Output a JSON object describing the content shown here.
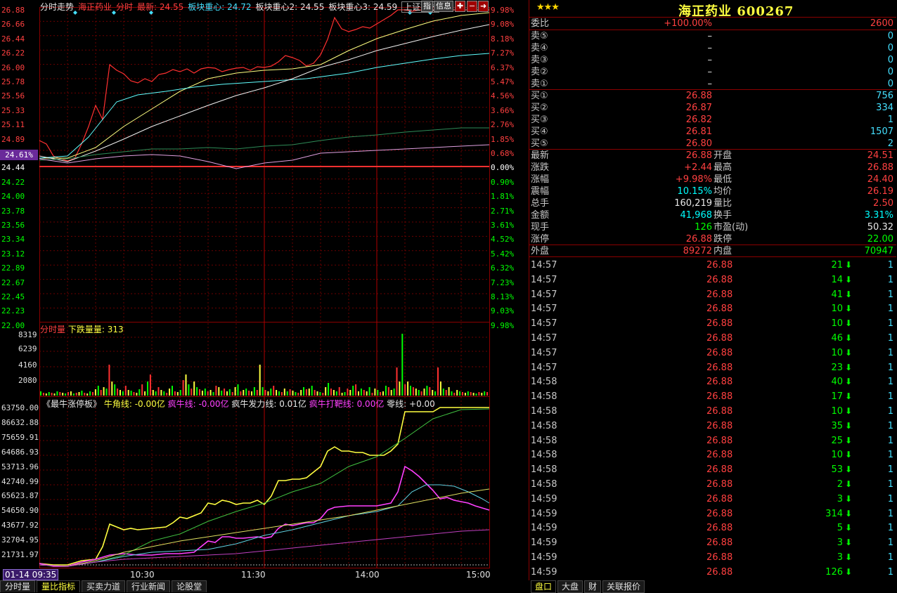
{
  "chart_header": {
    "title": "分时走势",
    "name": "海正药业",
    "mode": "分时",
    "latest": "最新: 24.55",
    "sector1": "板块重心: 24.72",
    "sector2": "板块重心2: 24.55",
    "sector3": "板块重心3: 24.59",
    "index_btn": "上证指数",
    "zhi_btn": "指",
    "info_btn": "信息"
  },
  "price_axis": {
    "left": [
      "26.88",
      "26.66",
      "26.44",
      "26.22",
      "26.00",
      "25.78",
      "25.56",
      "25.33",
      "25.11",
      "24.89",
      "24.44",
      "24.22",
      "24.00",
      "23.78",
      "23.56",
      "23.34",
      "23.12",
      "22.89",
      "22.67",
      "22.45",
      "22.23",
      "22.00"
    ],
    "highlight": "24.61%",
    "right": [
      "9.98%",
      "9.08%",
      "8.18%",
      "7.27%",
      "6.37%",
      "5.47%",
      "4.56%",
      "3.66%",
      "2.76%",
      "1.85%",
      "0.68%",
      "0.00%",
      "0.90%",
      "1.81%",
      "2.71%",
      "3.61%",
      "4.52%",
      "5.42%",
      "6.32%",
      "7.23%",
      "8.13%",
      "9.03%",
      "9.98%"
    ]
  },
  "volume_panel": {
    "title": "分时量",
    "subtitle": "下跌量量: 313",
    "axis": [
      "8319",
      "6239",
      "4160",
      "2080"
    ]
  },
  "indicator_panel": {
    "name": "《最牛涨停板》",
    "l1": "牛角线: -0.00亿",
    "l2": "疯牛线: -0.00亿",
    "l3": "疯牛发力线: 0.01亿",
    "l4": "疯牛打靶线: 0.00亿",
    "l5": "零线: +0.00",
    "axis": [
      "63750.00",
      "86632.88",
      "75659.91",
      "64686.93",
      "53713.96",
      "42740.99",
      "65623.87",
      "54650.90",
      "43677.92",
      "32704.95",
      "21731.97"
    ]
  },
  "time_axis": [
    "10:30",
    "11:30",
    "14:00",
    "15:00"
  ],
  "cursor_time": "01-14 09:35",
  "bottom_tabs": [
    "分时量",
    "量比指标",
    "买卖力道",
    "行业新闻",
    "论股堂"
  ],
  "right_tabs": [
    "盘口",
    "大盘",
    "财",
    "关联报价"
  ],
  "quote": {
    "stars": "★★★",
    "title": "海正药业 600267",
    "weibi_label": "委比",
    "weibi": "+100.00%",
    "weicha": "2600",
    "sell": [
      {
        "label": "卖⑤",
        "price": "–",
        "vol": "0"
      },
      {
        "label": "卖④",
        "price": "–",
        "vol": "0"
      },
      {
        "label": "卖③",
        "price": "–",
        "vol": "0"
      },
      {
        "label": "卖②",
        "price": "–",
        "vol": "0"
      },
      {
        "label": "卖①",
        "price": "–",
        "vol": "0"
      }
    ],
    "buy": [
      {
        "label": "买①",
        "price": "26.88",
        "vol": "756"
      },
      {
        "label": "买②",
        "price": "26.87",
        "vol": "334"
      },
      {
        "label": "买③",
        "price": "26.82",
        "vol": "1"
      },
      {
        "label": "买④",
        "price": "26.81",
        "vol": "1507"
      },
      {
        "label": "买⑤",
        "price": "26.80",
        "vol": "2"
      }
    ],
    "stats": [
      {
        "k1": "最新",
        "v1": "26.88",
        "k2": "开盘",
        "v2": "24.51"
      },
      {
        "k1": "涨跌",
        "v1": "+2.44",
        "k2": "最高",
        "v2": "26.88"
      },
      {
        "k1": "涨幅",
        "v1": "+9.98%",
        "k2": "最低",
        "v2": "24.40"
      },
      {
        "k1": "震幅",
        "v1": "10.15%",
        "k2": "均价",
        "v2": "26.19"
      },
      {
        "k1": "总手",
        "v1": "160,219",
        "k2": "量比",
        "v2": "2.50"
      },
      {
        "k1": "金额",
        "v1": "41,968",
        "k2": "换手",
        "v2": "3.31%"
      },
      {
        "k1": "现手",
        "v1": "126",
        "k2": "市盈(动)",
        "v2": "50.32"
      },
      {
        "k1": "涨停",
        "v1": "26.88",
        "k2": "跌停",
        "v2": "22.00"
      },
      {
        "k1": "外盘",
        "v1": "89272",
        "k2": "内盘",
        "v2": "70947"
      }
    ],
    "ticks": [
      {
        "t": "14:57",
        "p": "26.88",
        "v": "21",
        "n": "1"
      },
      {
        "t": "14:57",
        "p": "26.88",
        "v": "14",
        "n": "1"
      },
      {
        "t": "14:57",
        "p": "26.88",
        "v": "41",
        "n": "1"
      },
      {
        "t": "14:57",
        "p": "26.88",
        "v": "10",
        "n": "1"
      },
      {
        "t": "14:57",
        "p": "26.88",
        "v": "10",
        "n": "1"
      },
      {
        "t": "14:57",
        "p": "26.88",
        "v": "46",
        "n": "1"
      },
      {
        "t": "14:57",
        "p": "26.88",
        "v": "10",
        "n": "1"
      },
      {
        "t": "14:57",
        "p": "26.88",
        "v": "23",
        "n": "1"
      },
      {
        "t": "14:58",
        "p": "26.88",
        "v": "40",
        "n": "1"
      },
      {
        "t": "14:58",
        "p": "26.88",
        "v": "17",
        "n": "1"
      },
      {
        "t": "14:58",
        "p": "26.88",
        "v": "10",
        "n": "1"
      },
      {
        "t": "14:58",
        "p": "26.88",
        "v": "35",
        "n": "1"
      },
      {
        "t": "14:58",
        "p": "26.88",
        "v": "25",
        "n": "1"
      },
      {
        "t": "14:58",
        "p": "26.88",
        "v": "10",
        "n": "1"
      },
      {
        "t": "14:58",
        "p": "26.88",
        "v": "53",
        "n": "1"
      },
      {
        "t": "14:58",
        "p": "26.88",
        "v": "2",
        "n": "1"
      },
      {
        "t": "14:59",
        "p": "26.88",
        "v": "3",
        "n": "1"
      },
      {
        "t": "14:59",
        "p": "26.88",
        "v": "314",
        "n": "1"
      },
      {
        "t": "14:59",
        "p": "26.88",
        "v": "5",
        "n": "1"
      },
      {
        "t": "14:59",
        "p": "26.88",
        "v": "3",
        "n": "1"
      },
      {
        "t": "14:59",
        "p": "26.88",
        "v": "3",
        "n": "1"
      },
      {
        "t": "14:59",
        "p": "26.88",
        "v": "126",
        "n": "1"
      }
    ]
  },
  "colors": {
    "up": "#ff4040",
    "down": "#00ff00",
    "grid": "#8b0000",
    "accent": "#ffff40"
  }
}
